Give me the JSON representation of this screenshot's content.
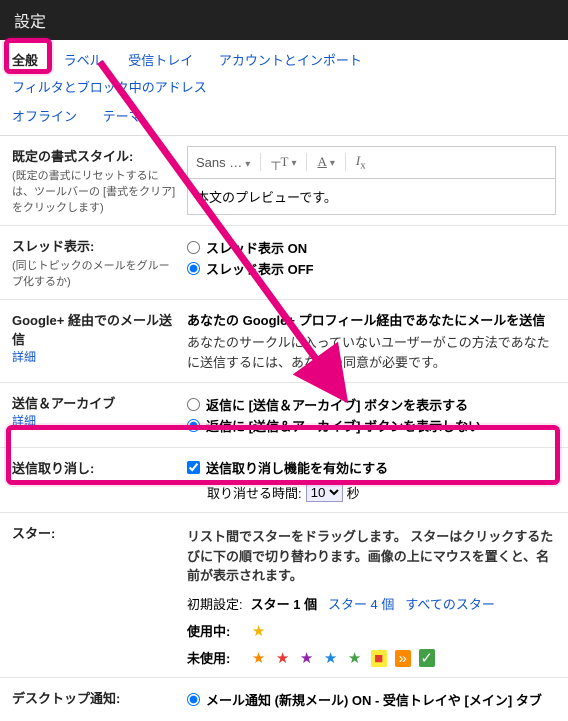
{
  "header": {
    "title": "設定"
  },
  "tabs": {
    "row1": [
      "全般",
      "ラベル",
      "受信トレイ",
      "アカウントとインポート",
      "フィルタとブロック中のアドレス"
    ],
    "row2": [
      "オフライン",
      "テーマ"
    ]
  },
  "format": {
    "title": "既定の書式スタイル:",
    "sub": "(既定の書式にリセットするには、ツールバーの [書式をクリア] をクリックします)",
    "font_label": "Sans …",
    "size_icon": "tT",
    "preview_text": "本文のプレビューです。"
  },
  "thread": {
    "title": "スレッド表示:",
    "sub": "(同じトピックのメールをグループ化するか)",
    "opt_on": "スレッド表示 ON",
    "opt_off": "スレッド表示 OFF"
  },
  "gplus": {
    "title": "Google+ 経由でのメール送信",
    "detail": "詳細",
    "line1": "あなたの Google+ プロフィール経由であなたにメールを送信",
    "line2": "あなたのサークルに入っていないユーザーがこの方法であなたに送信するには、あなたの同意が必要です。"
  },
  "archive": {
    "title": "送信＆アーカイブ",
    "detail": "詳細",
    "opt_show": "返信に [送信＆アーカイブ] ボタンを表示する",
    "opt_hide": "返信に [送信＆アーカイブ] ボタンを表示しない"
  },
  "undo": {
    "title": "送信取り消し:",
    "enable": "送信取り消し機能を有効にする",
    "time_label": "取り消せる時間:",
    "time_value": "10",
    "time_unit": "秒"
  },
  "stars": {
    "title": "スター:",
    "desc": "リスト間でスターをドラッグします。 スターはクリックするたびに下の順で切り替わります。画像の上にマウスを置くと、名前が表示されます。",
    "preset_label": "初期設定:",
    "preset_1": "スター 1 個",
    "preset_4": "スター 4 個",
    "preset_all": "すべてのスター",
    "inuse_label": "使用中:",
    "unused_label": "未使用:",
    "inuse_glyphs": [
      {
        "c": "★",
        "color": "#f4b400"
      }
    ],
    "unused_glyphs": [
      {
        "c": "★",
        "color": "#ff8a00"
      },
      {
        "c": "★",
        "color": "#e53935"
      },
      {
        "c": "★",
        "color": "#8e24aa"
      },
      {
        "c": "★",
        "color": "#1e88e5"
      },
      {
        "c": "★",
        "color": "#43a047"
      },
      {
        "c": "■",
        "color": "#e53935",
        "bg": "#ffeb3b"
      },
      {
        "c": "»",
        "color": "#fff",
        "bg": "#ff8a00"
      },
      {
        "c": "✓",
        "color": "#fff",
        "bg": "#43a047"
      }
    ]
  },
  "desktop": {
    "title": "デスクトップ通知:",
    "opt": "メール通知 (新規メール) ON - 受信トレイや [メイン] タブ"
  }
}
